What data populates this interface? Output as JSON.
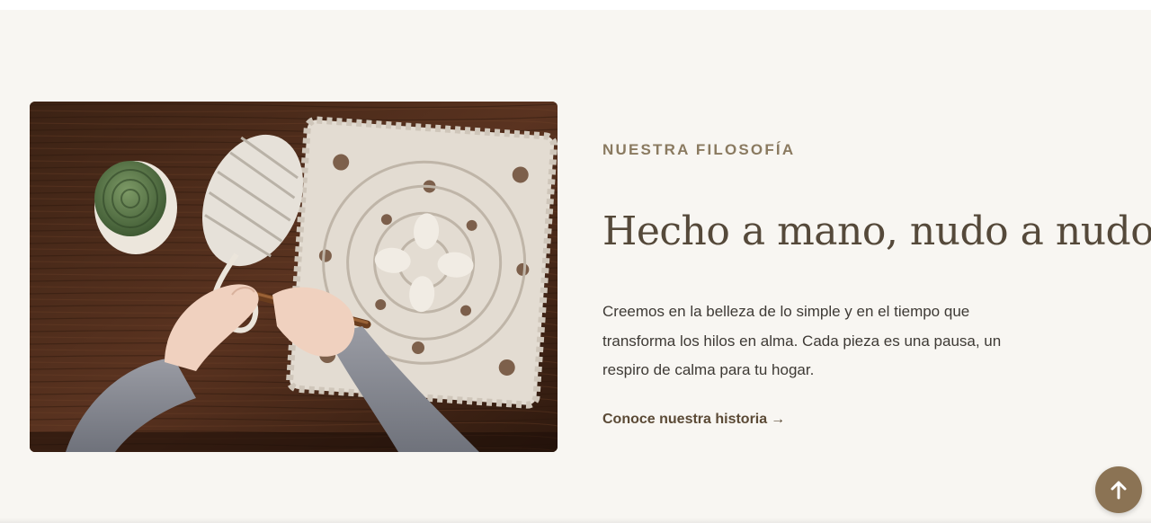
{
  "philosophy": {
    "eyebrow": "NUESTRA FILOSOFÍA",
    "headline": "Hecho a mano, nudo a nudo.",
    "body": "Creemos en la belleza de lo simple y en el tiempo que transforma los hilos en alma. Cada pieza es una pausa, un respiro de calma para tu hogar.",
    "cta_label": "Conoce nuestra historia",
    "cta_arrow": "→"
  },
  "image": {
    "subject": "hands-crocheting-granny-square"
  },
  "scroll_top": {
    "icon": "arrow-up-icon"
  },
  "colors": {
    "section_bg": "#f8f6f2",
    "accent": "#8b7354",
    "eyebrow": "#8a7a60",
    "heading": "#55493a",
    "body": "#3e3a35"
  }
}
